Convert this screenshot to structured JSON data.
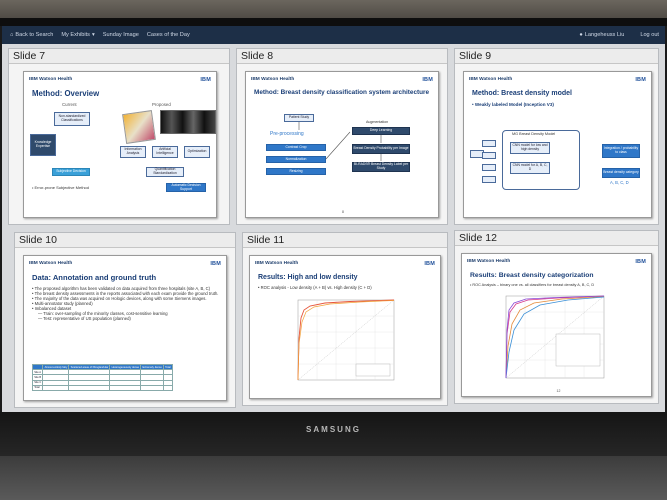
{
  "navbar": {
    "back": "Back to Search",
    "exhibits": "My Exhibits",
    "sunday": "Sunday Image",
    "cases": "Cases of the Day",
    "user": "Langeheuss Liu",
    "logout": "Log out"
  },
  "slides": [
    {
      "header": "Slide 7",
      "brand": "IBM Watson Health",
      "ibm": "IBM",
      "title": "Method: Overview",
      "current_label": "Current",
      "proposed_label": "Proposed",
      "boxes": [
        "Non-standardized Classifications",
        "Knowledge Expertise",
        "Subjective Decision",
        "Information Analysis",
        "Artificial Intelligence",
        "Optimization",
        "Quantification Standardization",
        "Automatic Decision Support"
      ],
      "bullet": "Error-prone Subjective Method"
    },
    {
      "header": "Slide 8",
      "brand": "IBM Watson Health",
      "ibm": "IBM",
      "title": "Method: Breast density classification system architecture",
      "boxes": [
        "Patient Study",
        "Pre-processing",
        "Contrast Crop",
        "Normalization",
        "Resizing",
        "Augmentation",
        "Deep Learning",
        "Breast Density Probability per Image",
        "BI-RADS® Breast Density Label per Study"
      ],
      "page": "8"
    },
    {
      "header": "Slide 9",
      "brand": "IBM Watson Health",
      "ibm": "IBM",
      "title": "Method: Breast density model",
      "bullet": "Weakly labeled Model (Inception V3)",
      "boxes": [
        "MG Breast Density Model",
        "CNN model for low and high density",
        "CNN model for A, B, C, D",
        "Integration / probability to class",
        "Breast density category",
        "A, B, C, D"
      ]
    },
    {
      "header": "Slide 10",
      "brand": "IBM Watson Health",
      "ibm": "IBM",
      "title": "Data: Annotation and ground truth",
      "bullets": [
        "The proposed algorithm has been validated on data acquired from three hospitals (site A, B, C)",
        "The breast density assessments in the reports associated with each exam provide the ground truth.",
        "The majority of the data was acquired on Hologic devices, along with some Siemens images.",
        "Multi-annotator study (planned)",
        "Imbalanced dataset",
        "— Train: over-sampling of the minority classes, cost-sensitive learning",
        "— Test: representative of US population (planned)"
      ],
      "table": [
        [
          "",
          "Almost entirely fatty",
          "Scattered areas of fibroglandular",
          "Heterogeneously dense",
          "Extremely dense",
          "Total"
        ],
        [
          "Site A",
          "",
          "",
          "",
          "",
          ""
        ],
        [
          "Site B",
          "",
          "",
          "",
          "",
          ""
        ],
        [
          "Site C",
          "",
          "",
          "",
          "",
          ""
        ],
        [
          "Total",
          "",
          "",
          "",
          "",
          ""
        ]
      ]
    },
    {
      "header": "Slide 11",
      "brand": "IBM Watson Health",
      "ibm": "IBM",
      "title": "Results: High and low density",
      "bullet": "ROC analysis - Low density (A + B) vs. High density (C + D)"
    },
    {
      "header": "Slide 12",
      "brand": "IBM Watson Health",
      "ibm": "IBM",
      "title": "Results: Breast density categorization",
      "bullet": "ROC Analysis – binary one vs. all classifiers for breast density A, B, C, D",
      "page": "12"
    }
  ],
  "monitor_brand": "SAMSUNG",
  "colors": {
    "navbar": "#1d2f47",
    "slide_title": "#1b3f77",
    "accent_blue": "#2f77c8"
  }
}
